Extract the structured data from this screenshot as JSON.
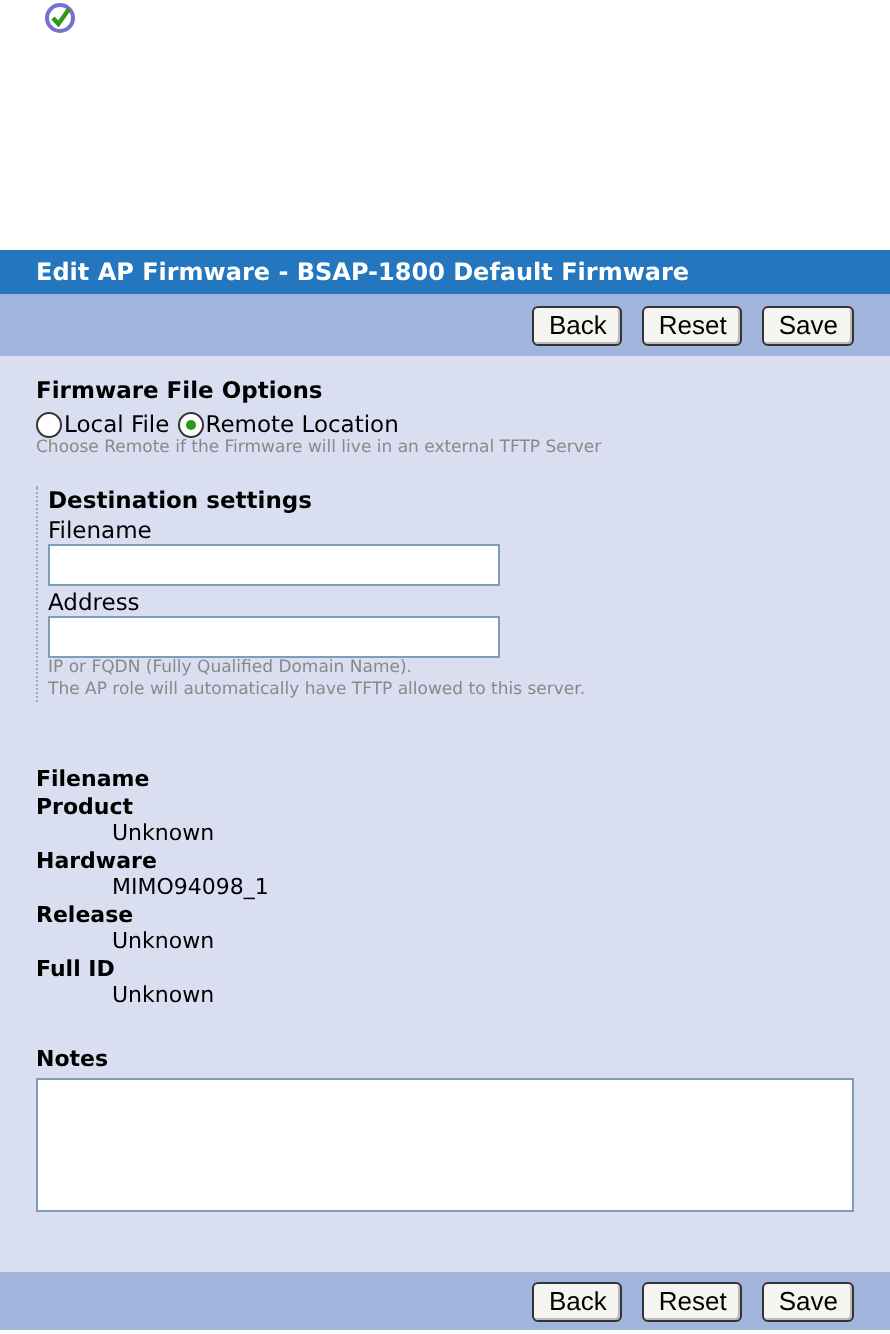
{
  "header": {
    "title": "Edit AP Firmware - BSAP-1800 Default Firmware"
  },
  "toolbar_top": {
    "buttons": [
      "Back",
      "Reset",
      "Save"
    ]
  },
  "file_options": {
    "heading": "Firmware File Options",
    "radios": [
      {
        "label": "Local File",
        "selected": false
      },
      {
        "label": "Remote Location",
        "selected": true
      }
    ],
    "hint": "Choose Remote if the Firmware will live in an external TFTP Server"
  },
  "destination": {
    "heading": "Destination settings",
    "fields": [
      {
        "label": "Filename"
      },
      {
        "label": "Address"
      }
    ],
    "hint_lines": [
      "IP or FQDN (Fully Qualified Domain Name).",
      "The AP role will automatically have TFTP allowed to this server."
    ]
  },
  "info": {
    "heading": "Filename",
    "items": [
      {
        "label": "Product",
        "value": "Unknown"
      },
      {
        "label": "Hardware",
        "value": "MIMO94098_1"
      },
      {
        "label": "Release",
        "value": "Unknown"
      },
      {
        "label": "Full ID",
        "value": "Unknown"
      }
    ]
  },
  "notes": {
    "label": "Notes"
  },
  "toolbar_bottom": {
    "buttons": [
      "Back",
      "Reset",
      "Save"
    ]
  }
}
